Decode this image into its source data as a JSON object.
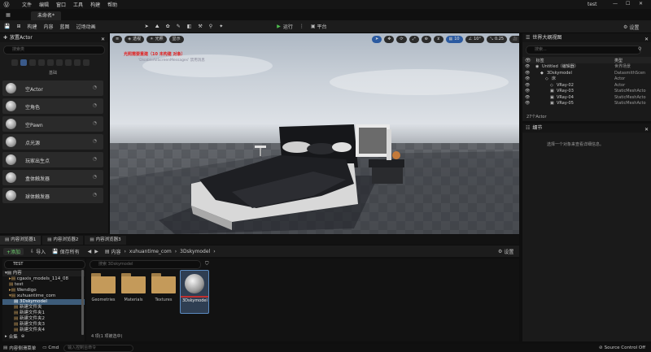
{
  "titlebar": {
    "menus": [
      "文件",
      "编辑",
      "窗口",
      "工具",
      "构建",
      "帮助"
    ],
    "project": "test",
    "win_min": "—",
    "win_max": "☐",
    "win_close": "✕"
  },
  "doc_tab": {
    "label": "未命名*"
  },
  "toolbar": {
    "save": "💾",
    "modes": "⊞",
    "build": "构建",
    "content": "内容",
    "blueprint": "蓝图",
    "cinematics": "过场动画",
    "play_label": "运行",
    "platform_label": "平台",
    "settings_label": "设置"
  },
  "place_actors": {
    "title": "放置Actor",
    "search_placeholder": "搜索类",
    "category_label": "基础",
    "items": [
      {
        "label": "空Actor"
      },
      {
        "label": "空角色"
      },
      {
        "label": "空Pawn"
      },
      {
        "label": "点光源"
      },
      {
        "label": "玩家出生点"
      },
      {
        "label": "盒体触发器"
      },
      {
        "label": "球体触发器"
      }
    ]
  },
  "viewport": {
    "perspective": "透视",
    "lit": "光照",
    "show": "显示",
    "warning_title": "光照需要重建（10 未构建 对象）",
    "warning_sub": "'DisableAllScreenMessages' 禁用消息",
    "grid": "10",
    "angle": "10°",
    "scale": "0.25",
    "camera": "4"
  },
  "outliner": {
    "title": "世界大纲视图",
    "search_placeholder": "搜索...",
    "col_label": "标签",
    "col_type": "类型",
    "rows": [
      {
        "label": "Untitled（编辑器）",
        "type": "世界场景"
      },
      {
        "label": "3Dskymodel",
        "type": "DatasmithScen"
      },
      {
        "label": "床",
        "type": "Actor"
      },
      {
        "label": "VRay-02",
        "type": "Actor"
      },
      {
        "label": "VRay-03",
        "type": "StaticMeshActo"
      },
      {
        "label": "VRay-04",
        "type": "StaticMeshActo"
      },
      {
        "label": "VRay-05",
        "type": "StaticMeshActo"
      }
    ],
    "count": "27个Actor"
  },
  "details": {
    "title": "细节",
    "empty": "选择一个对象来查看详细信息。"
  },
  "content_browser": {
    "tabs": [
      "内容浏览器1",
      "内容浏览器2",
      "内容浏览器3"
    ],
    "add": "+添加",
    "import": "导入",
    "save_all": "保存所有",
    "path": [
      "内容",
      "xuhuantime_com",
      "3Dskymodel"
    ],
    "settings": "设置",
    "tree_search": "TEST",
    "tree": [
      "内容",
      "cgaxis_models_114_08",
      "test",
      "Wendigo",
      "xuhuantime_com",
      "3Dskymodel",
      "新建文件夹",
      "新建文件夹1",
      "新建文件夹2",
      "新建文件夹3",
      "新建文件夹4"
    ],
    "collections": "合集",
    "search_placeholder": "搜索 3Dskymodel",
    "assets": [
      {
        "label": "Geometries"
      },
      {
        "label": "Materials"
      },
      {
        "label": "Textures"
      },
      {
        "label": "3Dskymodel"
      }
    ],
    "count": "4 项(1 项被选中)"
  },
  "statusbar": {
    "drawer": "内容侧滑菜单",
    "cmd": "Cmd",
    "console_placeholder": "输入控制台命令",
    "source_control": "Source Control Off"
  }
}
